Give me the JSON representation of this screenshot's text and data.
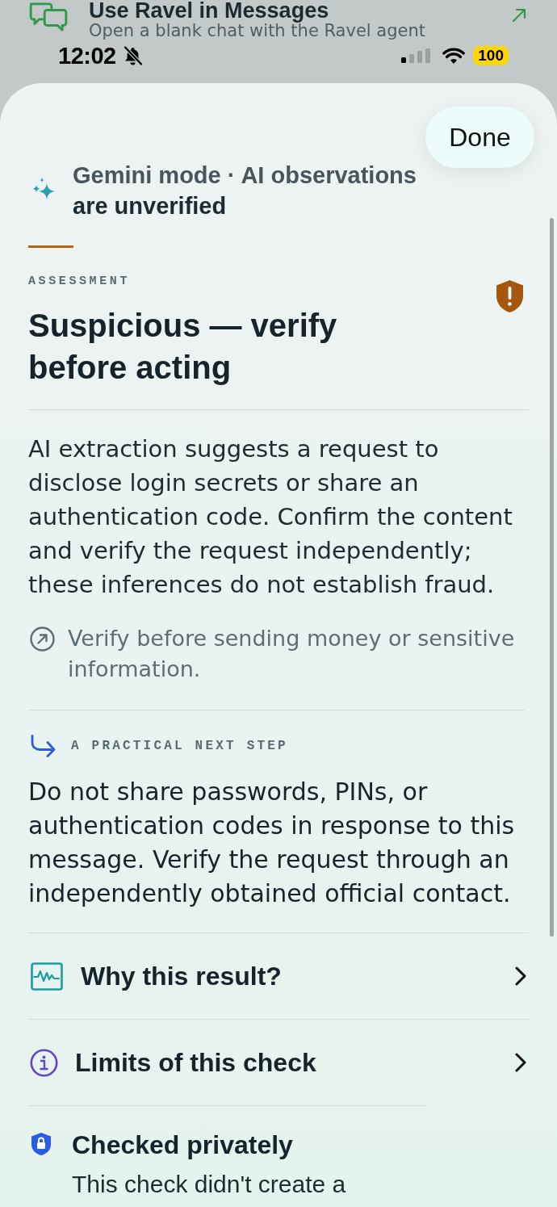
{
  "background_row": {
    "title": "Use Ravel in Messages",
    "subtitle": "Open a blank chat with the Ravel agent"
  },
  "status_bar": {
    "time": "12:02",
    "silent": true,
    "battery": "100"
  },
  "done_button": "Done",
  "mode_notice": {
    "label": "Gemini mode · AI observations",
    "note": "are unverified"
  },
  "assessment": {
    "eyebrow": "ASSESSMENT",
    "verdict": "Suspicious — verify before acting",
    "summary": "AI extraction suggests a request to disclose login secrets or share an authentication code. Confirm the content and verify the request independently; these inferences do not establish fraud.",
    "tip": "Verify before sending money or sensitive information."
  },
  "next_step": {
    "label": "A PRACTICAL NEXT STEP",
    "text": "Do not share passwords, PINs, or authentication codes in response to this message. Verify the request through an independently obtained official contact."
  },
  "links": [
    {
      "kind": "evidence",
      "label": "Why this result?"
    },
    {
      "kind": "info",
      "label": "Limits of this check"
    }
  ],
  "privacy": {
    "title": "Checked privately",
    "text": "This check didn't create a"
  }
}
